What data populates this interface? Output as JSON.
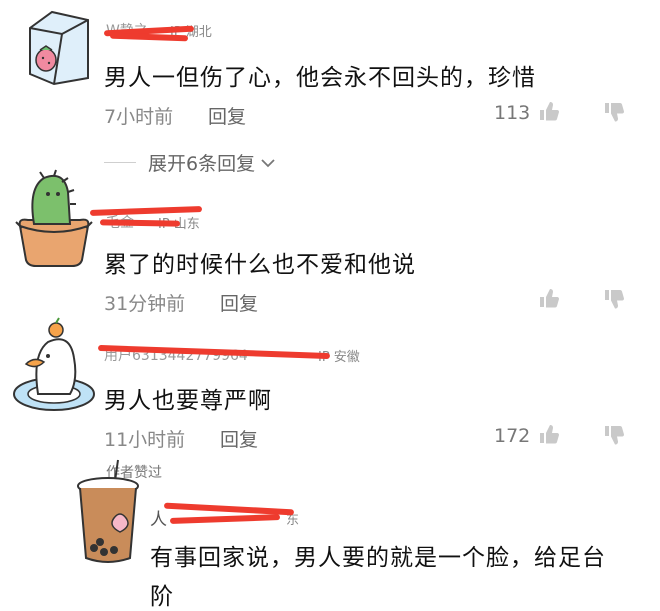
{
  "comments": [
    {
      "username_visible": "W静之",
      "ip_location": "IP 湖北",
      "text": "男人一但伤了心，他会永不回头的，珍惜",
      "time": "7小时前",
      "reply_label": "回复",
      "likes": "113",
      "expand_replies": "展开6条回复"
    },
    {
      "username_visible": "毛金",
      "ip_location": "IP 山东",
      "text": "累了的时候什么也不爱和他说",
      "time": "31分钟前",
      "reply_label": "回复",
      "likes": ""
    },
    {
      "username_visible": "用户6313442779964",
      "ip_location": "IP 安徽",
      "text": "男人也要尊严啊",
      "time": "11小时前",
      "reply_label": "回复",
      "likes": "172"
    }
  ],
  "reply": {
    "author_liked_badge": "作者赞过",
    "username_visible": "人",
    "ip_location": "东",
    "text_line1": "有事回家说，男人要的就是一个脸，给足台",
    "text_line2": "阶"
  },
  "colors": {
    "redaction": "#ee3b2e",
    "meta_gray": "#888888"
  },
  "icons": [
    "thumbs-up-icon",
    "thumbs-down-icon",
    "chevron-down-icon"
  ]
}
